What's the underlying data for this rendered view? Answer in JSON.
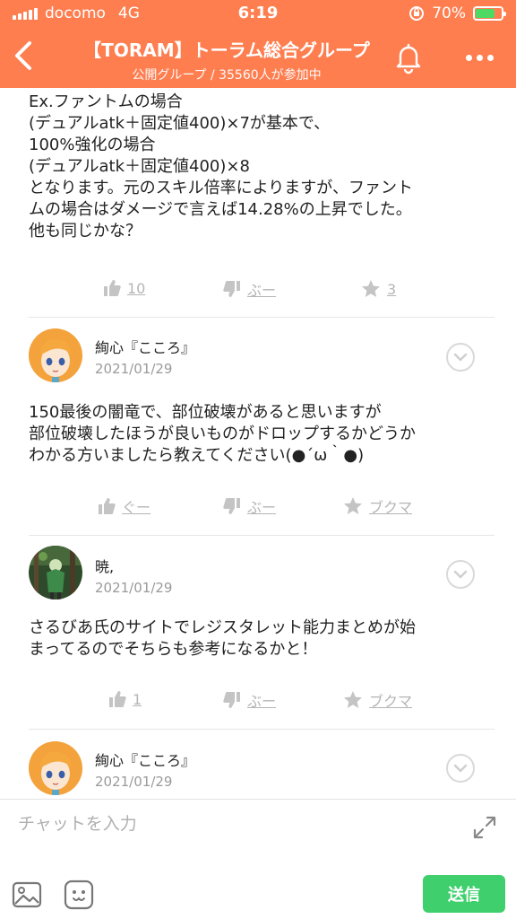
{
  "status_bar": {
    "carrier": "docomo",
    "network": "4G",
    "time": "6:19",
    "battery_percent": "70%",
    "battery_level": 0.7
  },
  "header": {
    "title": "【TORAM】トーラム総合グループ",
    "subtitle": "公開グループ / 35560人が参加中",
    "color": "#fe7e50"
  },
  "posts": [
    {
      "body": "Ex.ファントムの場合\n(デュアルatk＋固定値400)×7が基本で、\n100%強化の場合\n(デュアルatk＋固定値400)×8\nとなります。元のスキル倍率によりますが、ファント\nムの場合はダメージで言えば14.28%の上昇でした。\n他も同じかな？",
      "actions": {
        "like": "10",
        "dislike": "ぶー",
        "bookmark": "3"
      }
    },
    {
      "username": "絢心『こころ』",
      "date": "2021/01/29",
      "body": "150最後の闇竜で、部位破壊があると思いますが\n部位破壊したほうが良いものがドロップするかどうか\nわかる方いましたら教えてください(●´ω｀●)",
      "actions": {
        "like": "ぐー",
        "dislike": "ぶー",
        "bookmark": "ブクマ"
      }
    },
    {
      "username": "暁,",
      "date": "2021/01/29",
      "body": "さるびあ氏のサイトでレジスタレット能力まとめが始\nまってるのでそちらも参考になるかと！",
      "actions": {
        "like": "1",
        "dislike": "ぶー",
        "bookmark": "ブクマ"
      }
    },
    {
      "username": "絢心『こころ』",
      "date": "2021/01/29"
    }
  ],
  "input": {
    "placeholder": "チャットを入力",
    "send_label": "送信",
    "send_color": "#3fcf6c"
  }
}
